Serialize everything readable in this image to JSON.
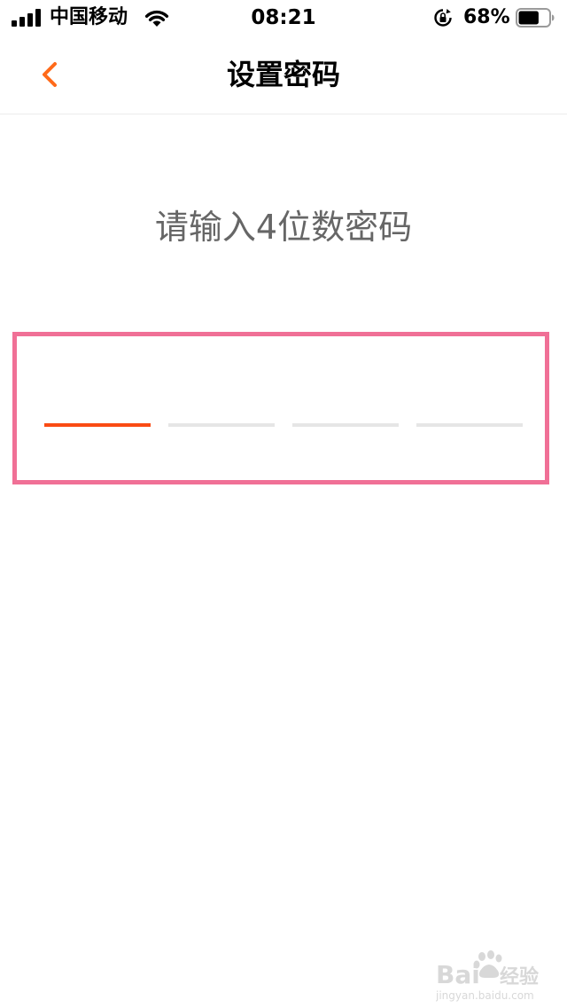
{
  "status_bar": {
    "carrier": "中国移动",
    "time": "08:21",
    "battery_percent": "68%",
    "battery_level": 0.68,
    "icons": [
      "signal-icon",
      "wifi-icon",
      "rotation-lock-icon",
      "battery-icon"
    ]
  },
  "nav": {
    "title": "设置密码",
    "back_icon": "chevron-left-icon"
  },
  "main": {
    "prompt": "请输入4位数密码",
    "pin_length": 4,
    "active_slot_index": 0
  },
  "watermark": {
    "text": "Bai经验",
    "url": "jingyan.baidu.com"
  },
  "colors": {
    "accent": "#fa4b14",
    "back_arrow": "#ff6a1a",
    "prompt_text": "#666666",
    "slot_inactive": "#e6e6e6",
    "highlight_border": "#f07096"
  }
}
